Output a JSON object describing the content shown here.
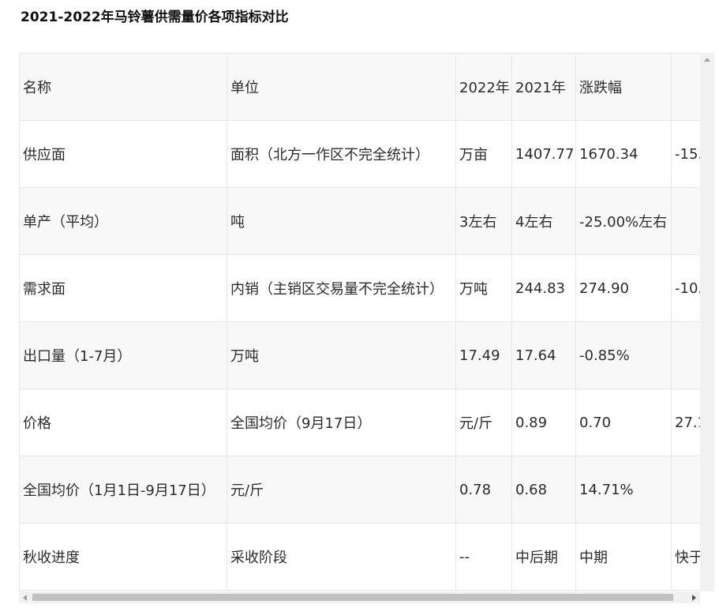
{
  "title": "2021-2022年马铃薯供需量价各项指标对比",
  "table": {
    "rows": [
      [
        "名称",
        "单位",
        "2022年",
        "2021年",
        "涨跌幅",
        ""
      ],
      [
        "供应面",
        "面积（北方一作区不完全统计）",
        "万亩",
        "1407.77",
        "1670.34",
        "-15."
      ],
      [
        "单产（平均）",
        "吨",
        "3左右",
        "4左右",
        "-25.00%左右",
        ""
      ],
      [
        "需求面",
        "内销（主销区交易量不完全统计）",
        "万吨",
        "244.83",
        "274.90",
        "-10."
      ],
      [
        "出口量（1-7月）",
        "万吨",
        "17.49",
        "17.64",
        "-0.85%",
        ""
      ],
      [
        "价格",
        "全国均价（9月17日）",
        "元/斤",
        "0.89",
        "0.70",
        "27.1"
      ],
      [
        "全国均价（1月1日-9月17日）",
        "元/斤",
        "0.78",
        "0.68",
        "14.71%",
        ""
      ],
      [
        "秋收进度",
        "采收阶段",
        "--",
        "中后期",
        "中期",
        "快于"
      ]
    ]
  },
  "icons": {
    "scroll_up": "arrow-up-icon",
    "scroll_left": "arrow-left-icon",
    "scroll_right": "arrow-right-icon"
  }
}
